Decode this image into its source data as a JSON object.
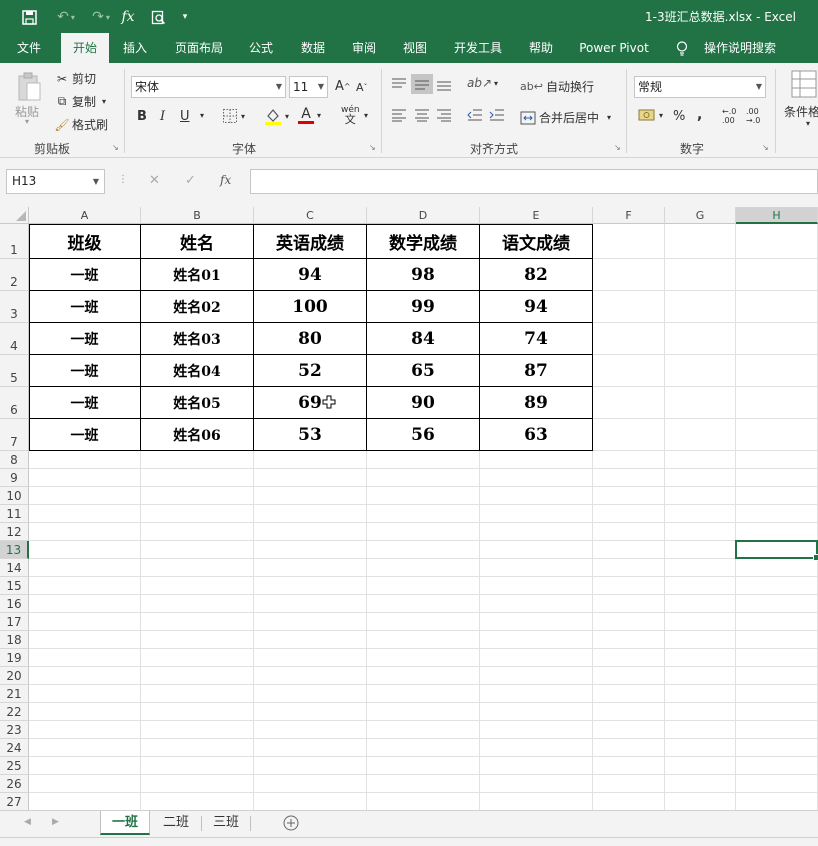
{
  "window": {
    "title": "1-3班汇总数据.xlsx  -  Excel"
  },
  "quick_access": {
    "fx": "fx"
  },
  "menu_tabs": [
    "文件",
    "开始",
    "插入",
    "页面布局",
    "公式",
    "数据",
    "审阅",
    "视图",
    "开发工具",
    "帮助",
    "Power Pivot",
    "操作说明搜索"
  ],
  "ribbon": {
    "clipboard": {
      "paste": "粘贴",
      "cut": "剪切",
      "copy": "复制",
      "format_painter": "格式刷",
      "label": "剪贴板"
    },
    "font": {
      "name": "宋体",
      "size": "11",
      "grow": "A",
      "shrink": "A",
      "bold": "B",
      "italic": "I",
      "underline": "U",
      "font_color": "A",
      "phonetic_top": "wén",
      "phonetic_bottom": "文",
      "label": "字体"
    },
    "alignment": {
      "wrap_text": "自动换行",
      "merge_center": "合并后居中",
      "label": "对齐方式"
    },
    "number": {
      "format": "常规",
      "percent": "%",
      "comma": ",",
      "inc_decimal": "←.0 .00",
      "dec_decimal": ".00 →.0",
      "label": "数字"
    },
    "styles": {
      "conditional": "条件格"
    }
  },
  "formula_bar": {
    "name_box": "H13",
    "cancel": "✕",
    "enter": "✓",
    "fx": "fx",
    "content": ""
  },
  "columns": [
    "A",
    "B",
    "C",
    "D",
    "E",
    "F",
    "G",
    "H"
  ],
  "rows": [
    "1",
    "2",
    "3",
    "4",
    "5",
    "6",
    "7",
    "8",
    "9",
    "10",
    "11",
    "12",
    "13",
    "14",
    "15",
    "16",
    "17",
    "18",
    "19",
    "20",
    "21",
    "22",
    "23",
    "24",
    "25",
    "26",
    "27"
  ],
  "table": {
    "header": [
      "班级",
      "姓名",
      "英语成绩",
      "数学成绩",
      "语文成绩"
    ],
    "rows": [
      [
        "一班",
        "姓名01",
        "94",
        "98",
        "82"
      ],
      [
        "一班",
        "姓名02",
        "100",
        "99",
        "94"
      ],
      [
        "一班",
        "姓名03",
        "80",
        "84",
        "74"
      ],
      [
        "一班",
        "姓名04",
        "52",
        "65",
        "87"
      ],
      [
        "一班",
        "姓名05",
        "69",
        "90",
        "89"
      ],
      [
        "一班",
        "姓名06",
        "53",
        "56",
        "63"
      ]
    ]
  },
  "selected_cell": "H13",
  "sheets": [
    "一班",
    "二班",
    "三班"
  ],
  "active_sheet": "一班",
  "colors": {
    "accent": "#217346"
  }
}
